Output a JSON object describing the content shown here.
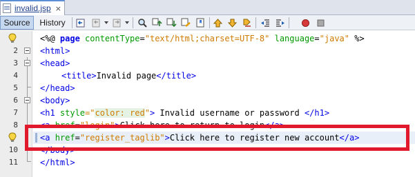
{
  "tab": {
    "label": "invalid.jsp",
    "close": "×",
    "icon": "jsp-file-icon"
  },
  "toolbar": {
    "source_label": "Source",
    "history_label": "History",
    "icons": [
      "last-edit-icon",
      "back-icon",
      "forward-icon",
      "find-icon",
      "find-previous-icon",
      "find-next-icon",
      "highlight-search-icon",
      "toggle-bookmark-icon",
      "previous-bookmark-icon",
      "next-bookmark-icon",
      "shift-left-icon",
      "shift-right-icon",
      "start-macro-icon",
      "stop-macro-icon"
    ]
  },
  "editor": {
    "lines": [
      {
        "n": "1",
        "parts": [
          "<%@ ",
          "page ",
          "contentType",
          "=",
          "\"text/html;charset=UTF-8\"",
          " ",
          "language",
          "=",
          "\"java\"",
          " %>"
        ]
      },
      {
        "n": "2",
        "parts": [
          "<html>"
        ]
      },
      {
        "n": "3",
        "parts": [
          "<head>"
        ]
      },
      {
        "n": "4",
        "parts": [
          "<title>",
          "Invalid page",
          "</title>"
        ]
      },
      {
        "n": "5",
        "parts": [
          "</head>"
        ]
      },
      {
        "n": "6",
        "parts": [
          "<body>"
        ]
      },
      {
        "n": "7",
        "parts": [
          "<h1 ",
          "style",
          "=\"",
          "color: red",
          "\"",
          ">",
          " Invalid username or password ",
          "</h1>"
        ]
      },
      {
        "n": "8",
        "parts": [
          "<a ",
          "href",
          "=",
          "\"login\"",
          ">",
          "Click here to return to login",
          "</a>"
        ]
      },
      {
        "n": "9",
        "parts": [
          "<a ",
          "href",
          "=",
          "\"register_taglib\"",
          ">",
          "Click here to register new account",
          "</a>"
        ]
      },
      {
        "n": "10",
        "parts": [
          "</body>"
        ]
      },
      {
        "n": "11",
        "parts": [
          "</html>"
        ]
      }
    ]
  },
  "colors": {
    "annotation": "#e0192c",
    "tag": "#0000e6",
    "attribute": "#009900",
    "value": "#ce7b00"
  }
}
